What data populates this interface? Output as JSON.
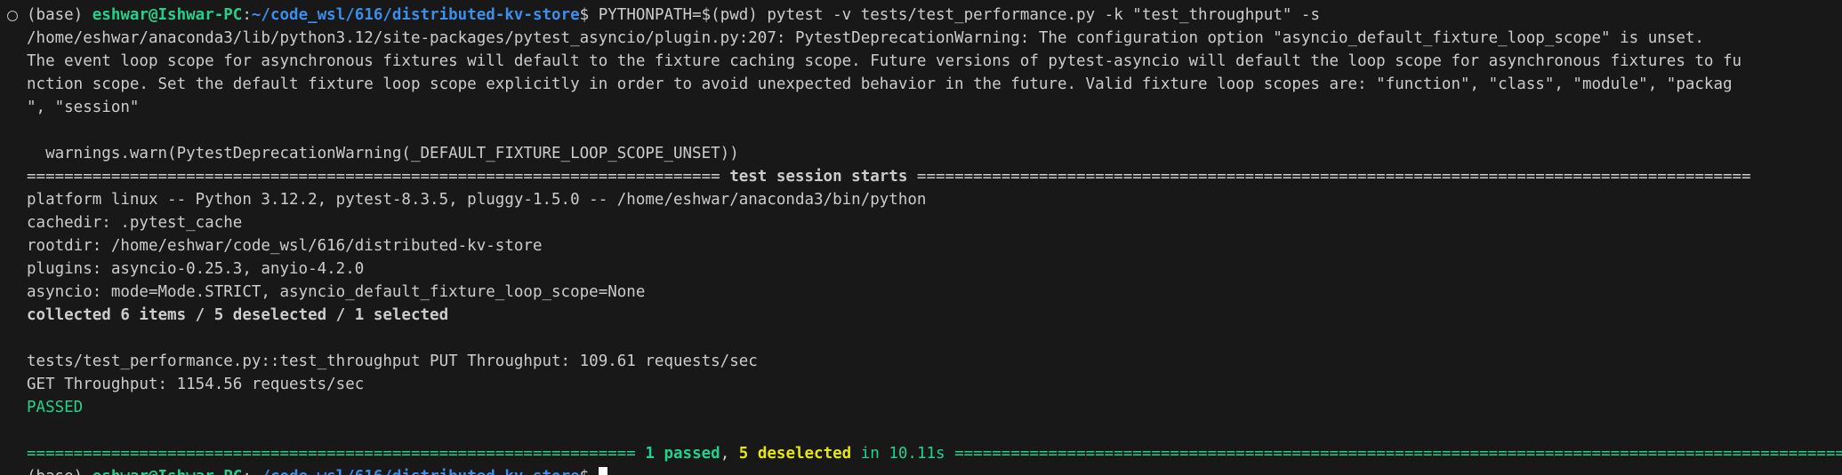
{
  "terminal": {
    "prompt": {
      "env": "(base) ",
      "user_host": "eshwar@Ishwar-PC",
      "sep": ":",
      "path": "~/code_wsl/616/distributed-kv-store",
      "symbol": "$ ",
      "command": "PYTHONPATH=$(pwd) pytest -v tests/test_performance.py -k \"test_throughput\" -s"
    },
    "warning_lines": [
      "/home/eshwar/anaconda3/lib/python3.12/site-packages/pytest_asyncio/plugin.py:207: PytestDeprecationWarning: The configuration option \"asyncio_default_fixture_loop_scope\" is unset.",
      "The event loop scope for asynchronous fixtures will default to the fixture caching scope. Future versions of pytest-asyncio will default the loop scope for asynchronous fixtures to fu",
      "nction scope. Set the default fixture loop scope explicitly in order to avoid unexpected behavior in the future. Valid fixture loop scopes are: \"function\", \"class\", \"module\", \"packag",
      "\", \"session\""
    ],
    "warn_call": "  warnings.warn(PytestDeprecationWarning(_DEFAULT_FIXTURE_LOOP_SCOPE_UNSET))",
    "session_header": {
      "left_rule": "==========================================================================",
      "title": " test session starts ",
      "right_rule": "========================================================================================="
    },
    "info_lines": [
      "platform linux -- Python 3.12.2, pytest-8.3.5, pluggy-1.5.0 -- /home/eshwar/anaconda3/bin/python",
      "cachedir: .pytest_cache",
      "rootdir: /home/eshwar/code_wsl/616/distributed-kv-store",
      "plugins: asyncio-0.25.3, anyio-4.2.0",
      "asyncio: mode=Mode.STRICT, asyncio_default_fixture_loop_scope=None"
    ],
    "collected": "collected 6 items / 5 deselected / 1 selected",
    "test_lines": [
      "tests/test_performance.py::test_throughput PUT Throughput: 109.61 requests/sec",
      "GET Throughput: 1154.56 requests/sec"
    ],
    "passed_label": "PASSED",
    "summary": {
      "left_rule": "=================================================================",
      "passed": "1 passed",
      "comma": ", ",
      "deselected": "5 deselected",
      "time": " in 10.11s ",
      "right_rule": "===================================================================================================="
    }
  },
  "colors": {
    "background": "#181818",
    "text": "#cccccc",
    "green": "#23d18b",
    "blue": "#3b8eea",
    "yellow": "#e5e510"
  }
}
